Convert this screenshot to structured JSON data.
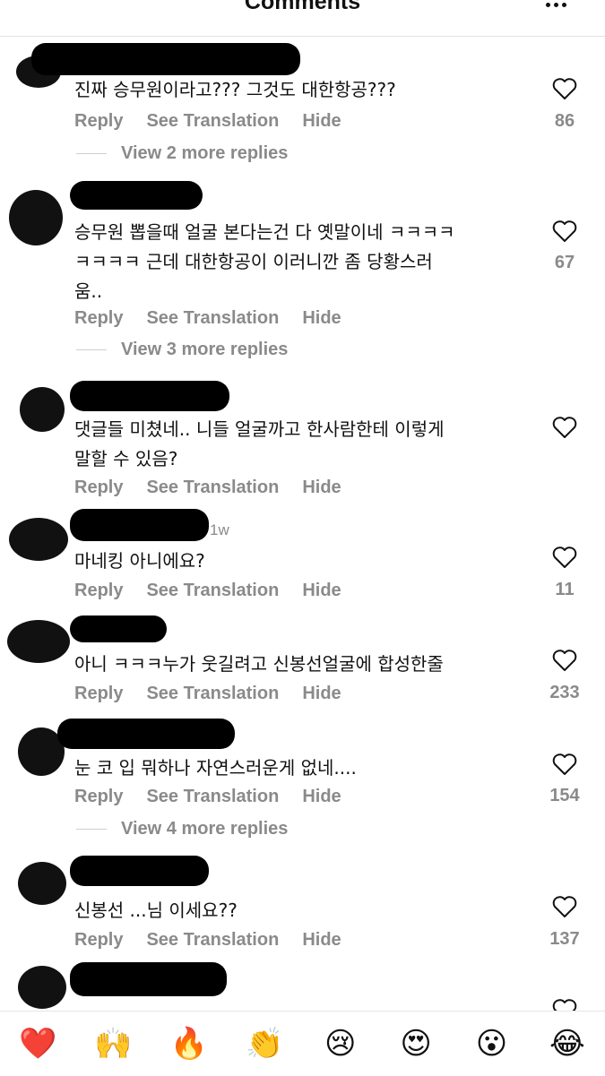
{
  "header": {
    "title": "Comments"
  },
  "labels": {
    "reply": "Reply",
    "see_translation": "See Translation",
    "hide": "Hide"
  },
  "comments": [
    {
      "text": "진짜 승무원이라고??? 그것도 대한항공???",
      "likes": "86",
      "view_more": "View 2 more replies"
    },
    {
      "text": "승무원 뽑을때 얼굴 본다는건 다 옛말이네 ㅋㅋㅋㅋ\nㅋㅋㅋㅋ 근데 대한항공이 이러니깐 좀 당황스러\n움..",
      "likes": "67",
      "view_more": "View 3 more replies"
    },
    {
      "text": "댓글들 미쳤네.. 니들 얼굴까고 한사람한테 이렇게\n말할 수 있음?",
      "likes": ""
    },
    {
      "text": "마네킹 아니에요?",
      "likes": "11",
      "time": "1w"
    },
    {
      "text": "아니 ㅋㅋㅋ누가 웃길려고 신봉선얼굴에 합성한줄",
      "likes": "233"
    },
    {
      "text": "눈 코 입 뭐하나 자연스러운게 없네....",
      "likes": "154",
      "view_more": "View 4 more replies"
    },
    {
      "text": "신봉선 ...님 이세요??",
      "likes": "137"
    },
    {
      "text": "",
      "likes": ""
    }
  ],
  "emoji_bar": [
    "❤️",
    "🙌",
    "🔥",
    "👏",
    "😢",
    "😍",
    "😮",
    "😂"
  ]
}
